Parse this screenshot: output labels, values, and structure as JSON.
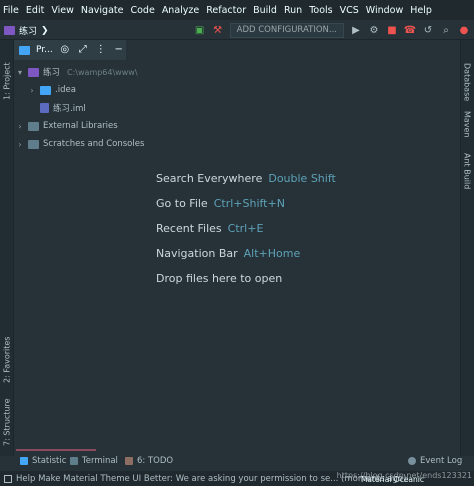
{
  "menu": {
    "items": [
      "File",
      "Edit",
      "View",
      "Navigate",
      "Code",
      "Analyze",
      "Refactor",
      "Build",
      "Run",
      "Tools",
      "VCS",
      "Window",
      "Help"
    ]
  },
  "toolbar": {
    "project_name": "练习",
    "config_label": "ADD CONFIGURATION..."
  },
  "panel": {
    "title": "Pr...",
    "collapse_glyph": "−"
  },
  "left_tabs": {
    "project": "1: Project",
    "favorites": "2: Favorites",
    "structure": "7: Structure"
  },
  "right_tabs": {
    "database": "Database",
    "maven": "Maven",
    "ant": "Ant Build"
  },
  "tree": {
    "root_label": "练习",
    "root_path": "C:\\wamp64\\www\\",
    "idea": ".idea",
    "iml": "练习.iml",
    "external": "External Libraries",
    "scratches": "Scratches and Consoles"
  },
  "hints": [
    {
      "label": "Search Everywhere",
      "shortcut": "Double Shift"
    },
    {
      "label": "Go to File",
      "shortcut": "Ctrl+Shift+N"
    },
    {
      "label": "Recent Files",
      "shortcut": "Ctrl+E"
    },
    {
      "label": "Navigation Bar",
      "shortcut": "Alt+Home"
    },
    {
      "label": "Drop files here to open",
      "shortcut": ""
    }
  ],
  "bottom_tabs": {
    "statistic": "Statistic",
    "terminal": "Terminal",
    "todo": "6: TODO",
    "event_log": "Event Log"
  },
  "status": {
    "message": "Help Make Material Theme UI Better: We are asking your permission to se... (moments ago)",
    "theme": "Material Oceanic",
    "watermark": "https://blog.csdn.net/ends123321"
  },
  "colors": {
    "background": "#263238",
    "accent": "#8b4a5e",
    "shortcut": "#5ea2b8"
  }
}
